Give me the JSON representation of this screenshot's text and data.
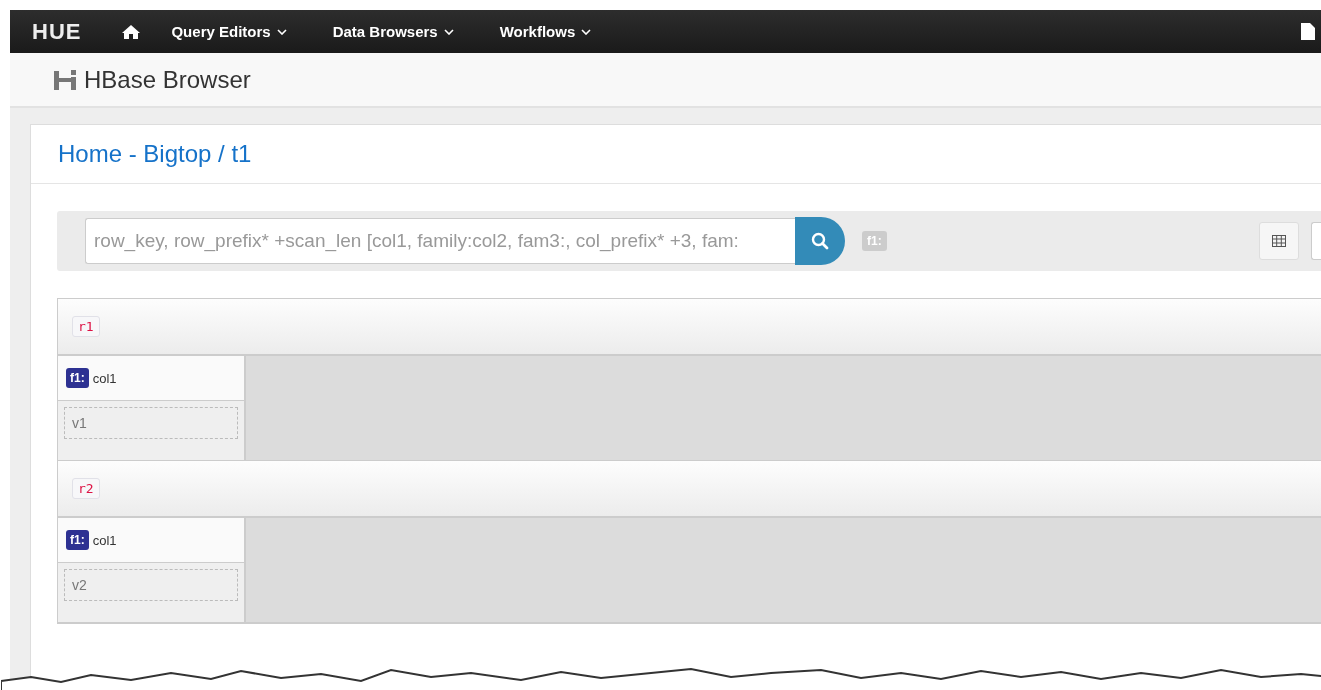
{
  "navbar": {
    "logo": "HUE",
    "menus": [
      {
        "label": "Query Editors"
      },
      {
        "label": "Data Browsers"
      },
      {
        "label": "Workflows"
      }
    ]
  },
  "app_header": {
    "title": "HBase Browser"
  },
  "breadcrumb": [
    {
      "label": "Home",
      "separator": " - "
    },
    {
      "label": "Bigtop",
      "separator": " / "
    },
    {
      "label": "t1"
    }
  ],
  "search": {
    "placeholder": "row_key, row_prefix* +scan_len [col1, family:col2, fam3:, col_prefix* +3, fam:",
    "families": [
      "f1:"
    ]
  },
  "rows": [
    {
      "key": "r1",
      "cells": [
        {
          "family": "f1:",
          "column": "col1",
          "value": "v1"
        }
      ]
    },
    {
      "key": "r2",
      "cells": [
        {
          "family": "f1:",
          "column": "col1",
          "value": "v2"
        }
      ]
    }
  ]
}
